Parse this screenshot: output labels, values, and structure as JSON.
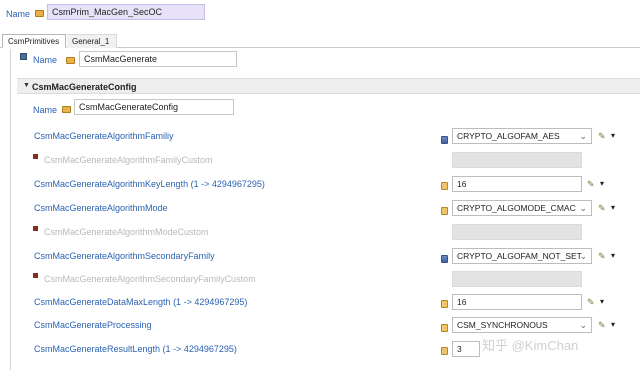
{
  "top": {
    "name_label": "Name",
    "name_value": "CsmPrim_MacGen_SecOC"
  },
  "tabs": [
    {
      "label": "CsmPrimitives"
    },
    {
      "label": "General_1"
    }
  ],
  "primitive": {
    "name_label": "Name",
    "name_value": "CsmMacGenerate"
  },
  "section": {
    "title": "CsmMacGenerateConfig",
    "name_label": "Name",
    "name_value": "CsmMacGenerateConfig"
  },
  "rows": [
    {
      "label": "CsmMacGenerateAlgorithmFamiliy",
      "value": "CRYPTO_ALGOFAM_AES"
    },
    {
      "label": "CsmMacGenerateAlgorithmFamilyCustom"
    },
    {
      "label": "CsmMacGenerateAlgorithmKeyLength (1 -> 4294967295)",
      "value": "16"
    },
    {
      "label": "CsmMacGenerateAlgorithmMode",
      "value": "CRYPTO_ALGOMODE_CMAC"
    },
    {
      "label": "CsmMacGenerateAlgorithmModeCustom"
    },
    {
      "label": "CsmMacGenerateAlgorithmSecondaryFamily",
      "value": "CRYPTO_ALGOFAM_NOT_SET"
    },
    {
      "label": "CsmMacGenerateAlgorithmSecondaryFamilyCustom"
    },
    {
      "label": "CsmMacGenerateDataMaxLength (1 -> 4294967295)",
      "value": "16"
    },
    {
      "label": "CsmMacGenerateProcessing",
      "value": "CSM_SYNCHRONOUS"
    },
    {
      "label": "CsmMacGenerateResultLength (1 -> 4294967295)",
      "value": "3"
    }
  ],
  "watermark": "知乎 @KimChan",
  "colors": {
    "label_blue": "#2a63b3",
    "name_highlight": "#e7e2f7",
    "disabled_field": "#e3e3e3"
  }
}
